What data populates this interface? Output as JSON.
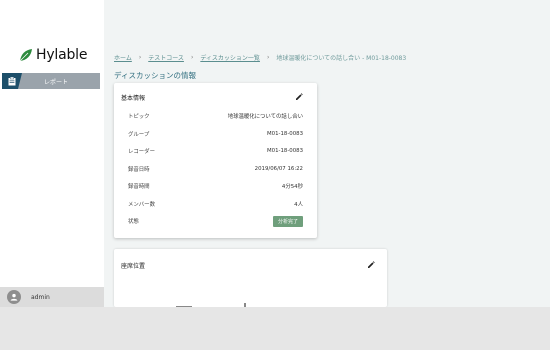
{
  "brand": {
    "name": "Hylable",
    "accent": "#1d4f6a",
    "leaf": "#2e8b3e"
  },
  "sidebar": {
    "items": [
      {
        "label": "レポート",
        "icon": "clipboard-icon"
      }
    ]
  },
  "user": {
    "name": "admin",
    "icon": "user-icon"
  },
  "breadcrumb": {
    "items": [
      "ホーム",
      "テストコース",
      "ディスカッション一覧"
    ],
    "current": "地球温暖化についての話し合い - M01-18-0083"
  },
  "page": {
    "title": "ディスカッションの情報"
  },
  "basic_info": {
    "title": "基本情報",
    "rows": [
      {
        "label": "トピック",
        "value": "地球温暖化についての話し合い"
      },
      {
        "label": "グループ",
        "value": "M01-18-0083"
      },
      {
        "label": "レコーダー",
        "value": "M01-18-0083"
      },
      {
        "label": "録音日時",
        "value": "2019/06/07 16:22"
      },
      {
        "label": "録音時間",
        "value": "4分54秒"
      },
      {
        "label": "メンバー数",
        "value": "4人"
      },
      {
        "label": "状態",
        "value": "分析完了"
      }
    ],
    "status_color": "#6f9f7c"
  },
  "seat": {
    "title": "座席位置"
  }
}
